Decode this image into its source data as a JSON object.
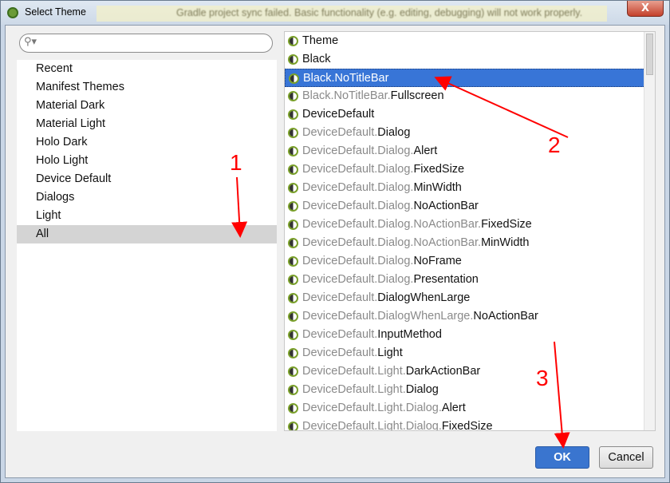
{
  "window": {
    "title": "Select Theme",
    "close_label": "X",
    "background_notice": "Gradle project sync failed. Basic functionality (e.g. editing, debugging) will not work properly."
  },
  "search": {
    "icon": "search-icon",
    "value": ""
  },
  "categories": [
    {
      "label": "Recent"
    },
    {
      "label": "Manifest Themes"
    },
    {
      "label": "Material Dark"
    },
    {
      "label": "Material Light"
    },
    {
      "label": "Holo Dark"
    },
    {
      "label": "Holo Light"
    },
    {
      "label": "Device Default"
    },
    {
      "label": "Dialogs"
    },
    {
      "label": "Light"
    },
    {
      "label": "All",
      "selected": true
    }
  ],
  "themes": [
    {
      "prefix": "",
      "name": "Theme"
    },
    {
      "prefix": "",
      "name": "Black"
    },
    {
      "prefix": "",
      "name": "Black.NoTitleBar",
      "selected": true
    },
    {
      "prefix": "Black.NoTitleBar.",
      "name": "Fullscreen"
    },
    {
      "prefix": "",
      "name": "DeviceDefault"
    },
    {
      "prefix": "DeviceDefault.",
      "name": "Dialog"
    },
    {
      "prefix": "DeviceDefault.Dialog.",
      "name": "Alert"
    },
    {
      "prefix": "DeviceDefault.Dialog.",
      "name": "FixedSize"
    },
    {
      "prefix": "DeviceDefault.Dialog.",
      "name": "MinWidth"
    },
    {
      "prefix": "DeviceDefault.Dialog.",
      "name": "NoActionBar"
    },
    {
      "prefix": "DeviceDefault.Dialog.NoActionBar.",
      "name": "FixedSize"
    },
    {
      "prefix": "DeviceDefault.Dialog.NoActionBar.",
      "name": "MinWidth"
    },
    {
      "prefix": "DeviceDefault.Dialog.",
      "name": "NoFrame"
    },
    {
      "prefix": "DeviceDefault.Dialog.",
      "name": "Presentation"
    },
    {
      "prefix": "DeviceDefault.",
      "name": "DialogWhenLarge"
    },
    {
      "prefix": "DeviceDefault.DialogWhenLarge.",
      "name": "NoActionBar"
    },
    {
      "prefix": "DeviceDefault.",
      "name": "InputMethod"
    },
    {
      "prefix": "DeviceDefault.",
      "name": "Light"
    },
    {
      "prefix": "DeviceDefault.Light.",
      "name": "DarkActionBar"
    },
    {
      "prefix": "DeviceDefault.Light.",
      "name": "Dialog"
    },
    {
      "prefix": "DeviceDefault.Light.Dialog.",
      "name": "Alert"
    },
    {
      "prefix": "DeviceDefault.Light.Dialog.",
      "name": "FixedSize"
    }
  ],
  "buttons": {
    "ok": "OK",
    "cancel": "Cancel"
  },
  "annotations": {
    "step1": "1",
    "step2": "2",
    "step3": "3",
    "color": "#ff0000"
  },
  "colors": {
    "selection": "#3875d7",
    "ok_button": "#3a75cf"
  }
}
